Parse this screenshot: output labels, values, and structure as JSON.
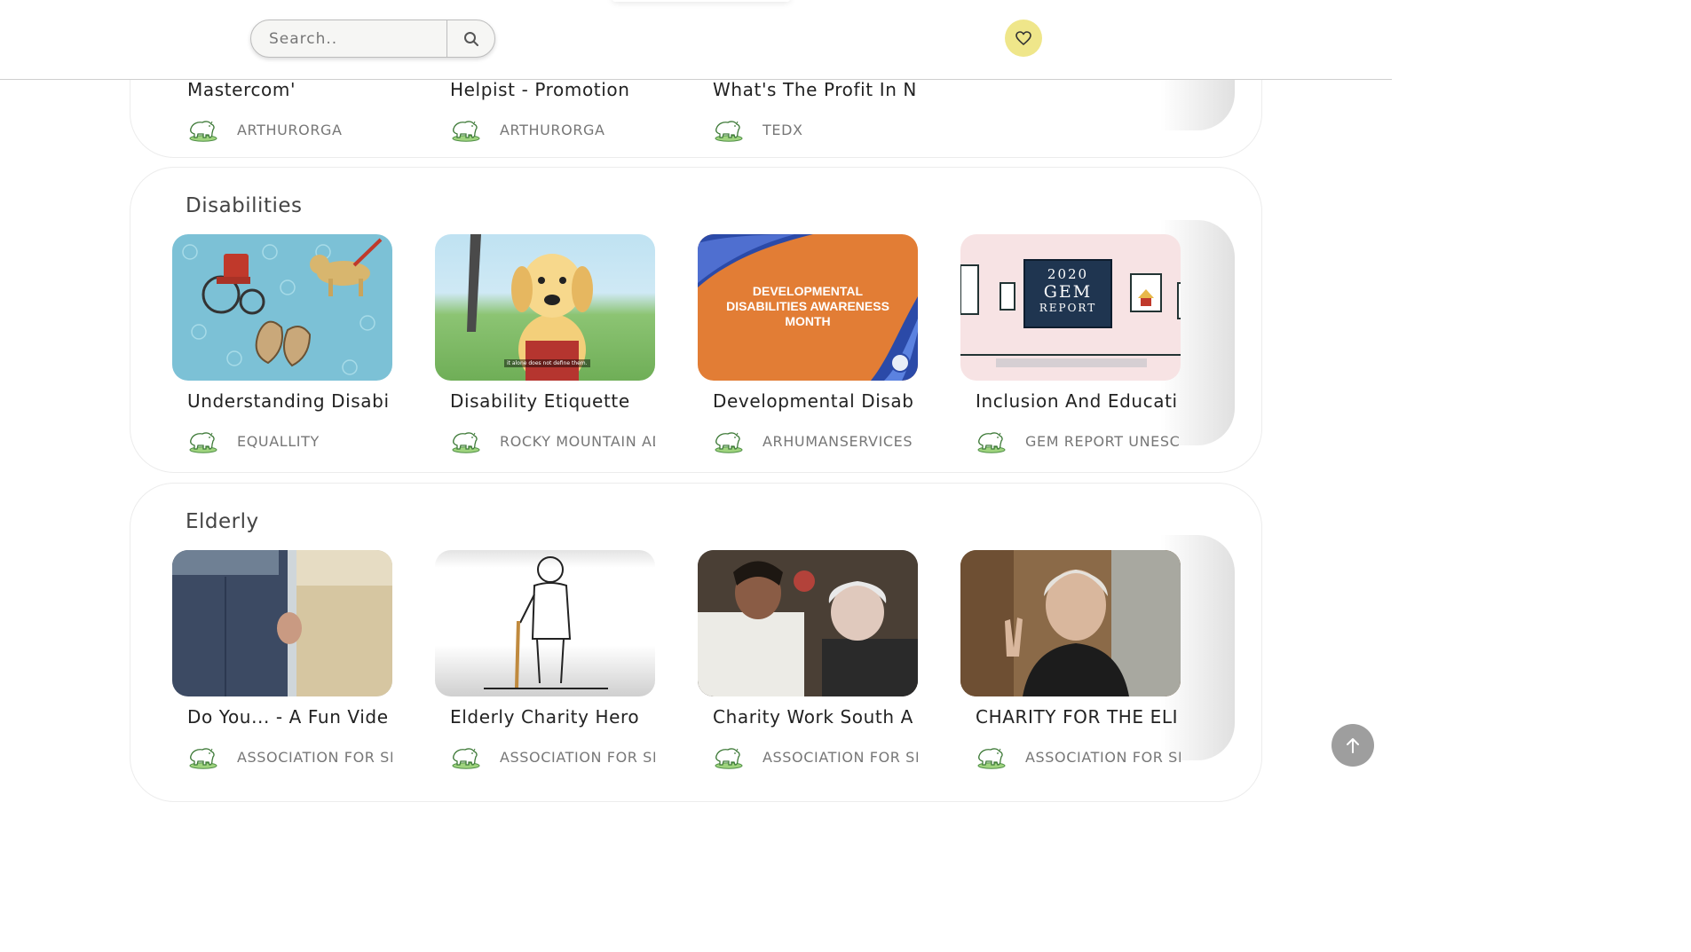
{
  "header": {
    "search_placeholder": "Search..",
    "search_icon": "search-icon",
    "favorites_icon": "heart-icon"
  },
  "top_row": {
    "cards": [
      {
        "title": "Mastercom'",
        "channel": "ARTHURORGA"
      },
      {
        "title": "Helpist - Promotion",
        "channel": "ARTHURORGA"
      },
      {
        "title": "What's The Profit In N",
        "channel": "TEDX"
      }
    ]
  },
  "disabilities": {
    "title": "Disabilities",
    "cards": [
      {
        "title": "Understanding Disabi",
        "channel": "EQUALLITY"
      },
      {
        "title": "Disability Etiquette",
        "channel": "ROCKY MOUNTAIN AD",
        "caption": "it alone does not define them."
      },
      {
        "title": "Developmental Disab",
        "channel": "ARHUMANSERVICES",
        "thumb_text": "DEVELOPMENTAL DISABILITIES AWARENESS MONTH"
      },
      {
        "title": "Inclusion And Educati",
        "channel": "GEM REPORT UNESCO",
        "thumb_text": [
          "2020",
          "GEM",
          "REPORT"
        ]
      }
    ]
  },
  "elderly": {
    "title": "Elderly",
    "cards": [
      {
        "title": "Do You... - A Fun Vide",
        "channel": "ASSOCIATION FOR SEN"
      },
      {
        "title": "Elderly Charity Hero",
        "channel": "ASSOCIATION FOR SEN"
      },
      {
        "title": "Charity Work South A",
        "channel": "ASSOCIATION FOR SEN"
      },
      {
        "title": "CHARITY FOR THE ELI",
        "channel": "ASSOCIATION FOR SEN"
      }
    ]
  },
  "scroll_top_icon": "arrow-up-icon",
  "colors": {
    "favorites_button": "#efe68a",
    "scroll_top_button": "#9e9e9e",
    "channel_icon_green": "#5a9a52"
  }
}
